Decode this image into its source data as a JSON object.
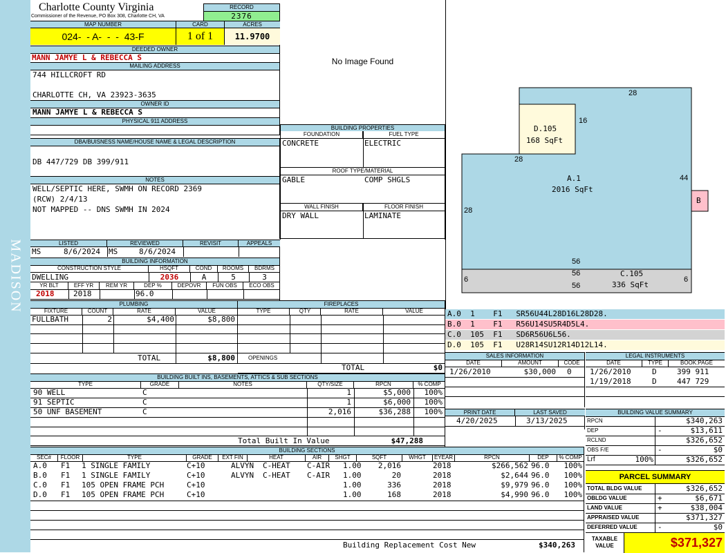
{
  "side_label": "MADISON",
  "county": {
    "name": "Charlotte County Virginia",
    "sub": "Commissioner of the Revenue, PO Box 308, Charlotte CH, VA"
  },
  "record": {
    "label": "RECORD",
    "value": "2376"
  },
  "map": {
    "label": "MAP NUMBER",
    "value": "024-  - A-  -  -  43-F",
    "card_label": "CARD",
    "card": "1 of 1",
    "acres_label": "ACRES",
    "acres": "11.9700"
  },
  "deeded_owner": {
    "label": "DEEDED OWNER",
    "value": "MANN JAMYE L & REBECCA S"
  },
  "mailing": {
    "label": "MAILING ADDRESS",
    "line1": "744 HILLCROFT RD",
    "line2": "CHARLOTTE CH, VA 23923-3635"
  },
  "owner_id": {
    "label": "OWNER ID",
    "value": "MANN JAMYE L & REBECCA S"
  },
  "physical": {
    "label": "PHYSICAL 911 ADDRESS",
    "value": ""
  },
  "dba": {
    "label": "DBA/BUISNESS NAME/HOUSE NAME & LEGAL DESCRIPTION",
    "value": "DB 447/729 DB 399/911"
  },
  "notes": {
    "label": "NOTES",
    "line1": "WELL/SEPTIC HERE, SWMH ON RECORD 2369",
    "line2": "(RCW) 2/4/13",
    "line3": "NOT MAPPED -- DNS SWMH IN 2024"
  },
  "photo": {
    "text": "No Image Found"
  },
  "building_properties": {
    "label": "BUILDING PROPERTIES",
    "foundation_label": "FOUNDATION",
    "foundation": "CONCRETE",
    "fuel_label": "FUEL TYPE",
    "fuel": "ELECTRIC",
    "roof_label": "ROOF TYPE/MATERIAL",
    "roof_type": "GABLE",
    "roof_material": "COMP SHGLS",
    "wall_label": "WALL FINISH",
    "wall": "DRY WALL",
    "floor_label": "FLOOR FINISH",
    "floor": "LAMINATE"
  },
  "listed": {
    "listed_label": "LISTED",
    "listed_by": "MS",
    "listed_date": "8/6/2024",
    "reviewed_label": "REVIEWED",
    "reviewed_by": "MS",
    "reviewed_date": "8/6/2024",
    "revisit_label": "REVISIT",
    "appeals_label": "APPEALS"
  },
  "building_info": {
    "label": "BUILDING INFORMATION",
    "style_label": "CONSTRUCTION STYLE",
    "style": "DWELLING",
    "hsqft_label": "HSQFT",
    "hsqft": "2036",
    "cond_label": "COND",
    "cond": "A",
    "rooms_label": "ROOMS",
    "rooms": "5",
    "bdrms_label": "BDRMS",
    "bdrms": "3",
    "yrblt_label": "YR BLT",
    "yrblt": "2018",
    "effyr_label": "EFF YR",
    "effyr": "2018",
    "remyr_label": "REM YR",
    "remyr": "",
    "dep_label": "DEP %",
    "dep": "96.0",
    "depovr_label": "DEPOVR",
    "funobs_label": "FUN OBS",
    "ecoobs_label": "ECO OBS"
  },
  "plumbing": {
    "label": "PLUMBING",
    "col_fixture": "FIXTURE",
    "col_count": "COUNT",
    "col_rate": "RATE",
    "col_value": "VALUE",
    "rows": [
      {
        "fixture": "FULLBATH",
        "count": "2",
        "rate": "$4,400",
        "value": "$8,800"
      }
    ],
    "total_label": "TOTAL",
    "total": "$8,800"
  },
  "fireplaces": {
    "label": "FIREPLACES",
    "col_type": "TYPE",
    "col_qty": "QTY",
    "col_rate": "RATE",
    "col_value": "VALUE",
    "openings_label": "OPENINGS",
    "total_label": "TOTAL",
    "total": "$0"
  },
  "built_ins": {
    "label": "BUILDING BUILT INS, BASEMENTS, ATTICS & SUB SECTIONS",
    "col_type": "TYPE",
    "col_grade": "GRADE",
    "col_notes": "NOTES",
    "col_qty": "QTY/SIZE",
    "col_rpcn": "RPCN",
    "col_comp": "% COMP",
    "rows": [
      {
        "type": "90 WELL",
        "grade": "C",
        "qty": "1",
        "rpcn": "$5,000",
        "comp": "100%"
      },
      {
        "type": "91 SEPTIC",
        "grade": "C",
        "qty": "1",
        "rpcn": "$6,000",
        "comp": "100%"
      },
      {
        "type": "50 UNF BASEMENT",
        "grade": "C",
        "qty": "2,016",
        "rpcn": "$36,288",
        "comp": "100%"
      }
    ],
    "total_label": "Total Built In Value",
    "total": "$47,288"
  },
  "sections": {
    "label": "BUILDING SECTIONS",
    "cols": [
      "SEC#",
      "FLOOR",
      "TYPE",
      "GRADE",
      "EXT FIN",
      "HEAT",
      "AIR",
      "SHGT",
      "SQFT",
      "WHGT",
      "EYEAR",
      "RPCN",
      "DEP",
      "% COMP"
    ],
    "rows": [
      {
        "sec": "A.0",
        "floor": "F1",
        "type": "1 SINGLE FAMILY",
        "grade": "C+10",
        "ext": "ALVYN",
        "heat": "C-HEAT",
        "air": "C-AIR",
        "shgt": "1.00",
        "sqft": "2,016",
        "eyear": "2018",
        "rpcn": "$266,562",
        "dep": "96.0",
        "comp": "100%"
      },
      {
        "sec": "B.0",
        "floor": "F1",
        "type": "1 SINGLE FAMILY",
        "grade": "C+10",
        "ext": "ALVYN",
        "heat": "C-HEAT",
        "air": "C-AIR",
        "shgt": "1.00",
        "sqft": "20",
        "eyear": "2018",
        "rpcn": "$2,644",
        "dep": "96.0",
        "comp": "100%"
      },
      {
        "sec": "C.0",
        "floor": "F1",
        "type": "105 OPEN FRAME PCH",
        "grade": "C+10",
        "ext": "",
        "heat": "",
        "air": "",
        "shgt": "1.00",
        "sqft": "336",
        "eyear": "2018",
        "rpcn": "$9,979",
        "dep": "96.0",
        "comp": "100%"
      },
      {
        "sec": "D.0",
        "floor": "F1",
        "type": "105 OPEN FRAME PCH",
        "grade": "C+10",
        "ext": "",
        "heat": "",
        "air": "",
        "shgt": "1.00",
        "sqft": "168",
        "eyear": "2018",
        "rpcn": "$4,990",
        "dep": "96.0",
        "comp": "100%"
      }
    ],
    "total_label": "Building Replacement Cost New",
    "total": "$340,263"
  },
  "sketch": {
    "areas": {
      "a_name": "A.1",
      "a_sqft": "2016 SqFt",
      "c_name": "C.105",
      "c_sqft": "336 SqFt",
      "d_name": "D.105",
      "d_sqft": "168 SqFt",
      "b_name": "B"
    },
    "dims": {
      "top": "28",
      "d_right": "16",
      "d_bottom": "28",
      "right": "44",
      "left": "28",
      "bottom": "56",
      "c_top": "56",
      "c_bottom": "56",
      "c_left": "6",
      "c_right": "6"
    },
    "colors": {
      "a": "#add8e6",
      "b": "#ffc0cb",
      "c": "#d3d3d3",
      "d": "#fffadc"
    },
    "codes": [
      {
        "code": "A.0  1    F1   SR56U44L28D16L28D28.",
        "color": "#add8e6"
      },
      {
        "code": "B.0  1    F1   R56U14SU5R4D5L4.",
        "color": "#ffc0cb"
      },
      {
        "code": "C.0  105  F1   SD6R56U6L56.",
        "color": "#d3d3d3"
      },
      {
        "code": "D.0  105  F1   U28R14SU12R14D12L14.",
        "color": "#fffadc"
      }
    ]
  },
  "sales": {
    "label": "SALES INFORMATION",
    "col_date": "DATE",
    "col_amount": "AMOUNT",
    "col_code": "CODE",
    "rows": [
      {
        "date": "1/26/2010",
        "amount": "$30,000",
        "code": "0"
      }
    ]
  },
  "legal": {
    "label": "LEGAL INSTRUMENTS",
    "col_date": "DATE",
    "col_type": "TYPE",
    "col_book": "BOOK:PAGE",
    "rows": [
      {
        "date": "1/26/2010",
        "type": "D",
        "book": "399 911"
      },
      {
        "date": "1/19/2018",
        "type": "D",
        "book": "447 729"
      }
    ]
  },
  "print": {
    "print_label": "PRINT DATE",
    "print_date": "4/20/2025",
    "saved_label": "LAST SAVED",
    "saved_date": "3/13/2025"
  },
  "bvs": {
    "label": "BUILDING VALUE SUMMARY",
    "rpcn_label": "RPCN",
    "rpcn": "$340,263",
    "dep_label": "DEP",
    "dep_sign": "-",
    "dep": "$13,611",
    "rclnd_label": "RCLND",
    "rclnd": "$326,652",
    "obs_label": "OBS F/E",
    "obs_sign": "-",
    "obs": "$0",
    "lrf_label": "Lrf",
    "lrf_pct": "100%",
    "lrf": "$326,652"
  },
  "parcel": {
    "label": "PARCEL SUMMARY",
    "tbv_label": "TOTAL BLDG VALUE",
    "tbv": "$326,652",
    "obv_label": "OBLDG VALUE",
    "obv_sign": "+",
    "obv": "$6,671",
    "land_label": "LAND VALUE",
    "land_sign": "+",
    "land": "$38,004",
    "appr_label": "APPRAISED VALUE",
    "appr": "$371,327",
    "def_label": "DEFERRED VALUE",
    "def_sign": "-",
    "def": "$0",
    "taxable_label1": "TAXABLE",
    "taxable_label2": "VALUE",
    "taxable": "$371,327"
  }
}
